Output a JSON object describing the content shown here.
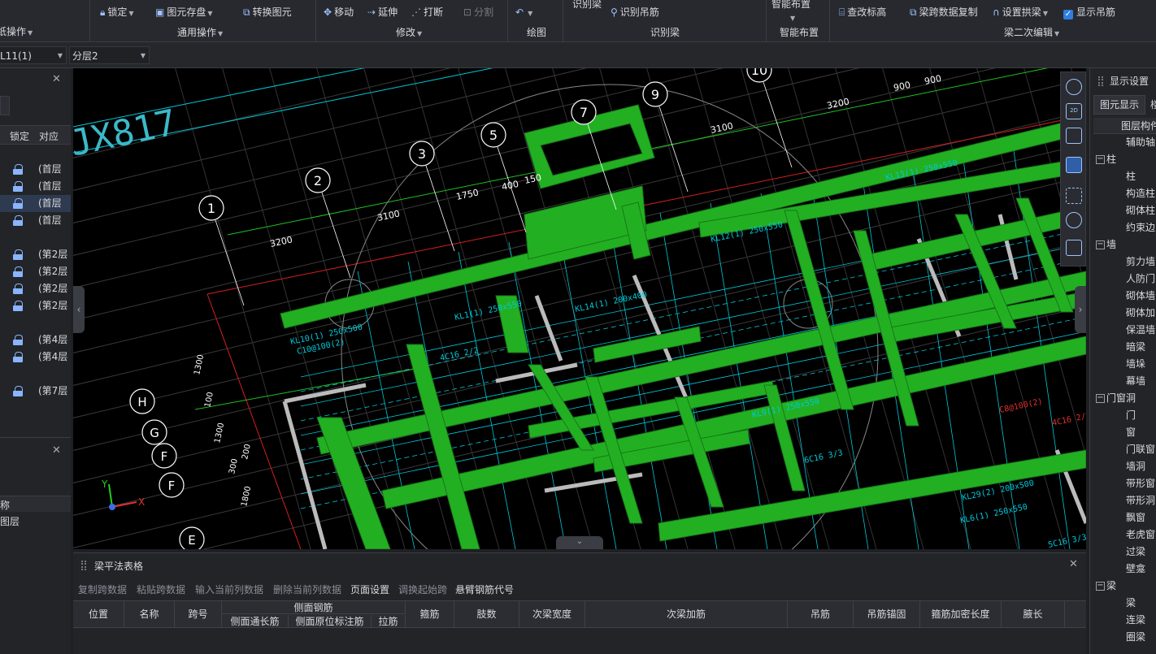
{
  "ribbon": {
    "left_group": "纸操作",
    "items": {
      "lock": "锁定",
      "save_elem": "图元存盘",
      "convert": "转换图元",
      "move": "移动",
      "extend": "延伸",
      "break": "打断",
      "split": "分割",
      "recognize_beam_top": "识别梁",
      "recognize_hanger": "识别吊筋",
      "smart_layout": "智能布置",
      "check_elev": "查改标高",
      "span_copy": "梁跨数据复制",
      "set_arch": "设置拱梁",
      "show_hanger": "显示吊筋"
    },
    "groups": {
      "general": "通用操作",
      "modify": "修改",
      "draw": "绘图",
      "recognize": "识别梁",
      "smart": "智能布置",
      "secondary": "梁二次编辑"
    }
  },
  "selectors": {
    "member": "L11(1)",
    "layer": "分层2"
  },
  "left_panel": {
    "col_lock": "锁定",
    "col_match": "对应",
    "rows": [
      "(首层",
      "(首层",
      "(首层",
      "(首层",
      "(第2层",
      "(第2层",
      "(第2层",
      "(第2层",
      "(第4层",
      "(第4层",
      "(第7层"
    ],
    "bottom_rows": [
      "称",
      "图层"
    ]
  },
  "cad": {
    "title_text": "JX817",
    "axis_numbers": [
      "1",
      "2",
      "3",
      "5",
      "7",
      "9",
      "10"
    ],
    "axis_letters": [
      "H",
      "G",
      "F",
      "F",
      "E"
    ],
    "dims_top": [
      "3200",
      "3100",
      "1750",
      "400",
      "150",
      "3100",
      "3200",
      "900",
      "900"
    ],
    "dims_left": [
      "1300",
      "100",
      "1300",
      "200",
      "300",
      "1800"
    ],
    "beam_labels": [
      "KL10(1) 250x500",
      "C10@100(2)",
      "KL1(1) 250x550",
      "KL14(1) 200x400",
      "KL13(1) 250x550",
      "KL12(1) 250x550",
      "KL9(1) 250x550",
      "KL29(2) 200x500",
      "KL6(1) 250x550",
      "4C16 2/2",
      "C8@100(2)",
      "4C16 2/2",
      "6C16 3/3",
      "5C16 3/3"
    ],
    "axis_x_label": "X",
    "axis_y_label": "Y"
  },
  "right_panel": {
    "title": "显示设置",
    "tab": "图元显示",
    "tab2": "楼",
    "header": "图层构件",
    "tree": [
      {
        "label": "辅助轴",
        "level": 2
      },
      {
        "label": "柱",
        "level": 1
      },
      {
        "label": "柱",
        "level": 2
      },
      {
        "label": "构造柱",
        "level": 2
      },
      {
        "label": "砌体柱",
        "level": 2
      },
      {
        "label": "约束边",
        "level": 2
      },
      {
        "label": "墙",
        "level": 1
      },
      {
        "label": "剪力墙",
        "level": 2
      },
      {
        "label": "人防门",
        "level": 2
      },
      {
        "label": "砌体墙",
        "level": 2
      },
      {
        "label": "砌体加",
        "level": 2
      },
      {
        "label": "保温墙",
        "level": 2
      },
      {
        "label": "暗梁",
        "level": 2
      },
      {
        "label": "墙垛",
        "level": 2
      },
      {
        "label": "幕墙",
        "level": 2
      },
      {
        "label": "门窗洞",
        "level": 1
      },
      {
        "label": "门",
        "level": 2
      },
      {
        "label": "窗",
        "level": 2
      },
      {
        "label": "门联窗",
        "level": 2
      },
      {
        "label": "墙洞",
        "level": 2
      },
      {
        "label": "带形窗",
        "level": 2
      },
      {
        "label": "带形洞",
        "level": 2
      },
      {
        "label": "飘窗",
        "level": 2
      },
      {
        "label": "老虎窗",
        "level": 2
      },
      {
        "label": "过梁",
        "level": 2
      },
      {
        "label": "壁龛",
        "level": 2
      },
      {
        "label": "梁",
        "level": 1
      },
      {
        "label": "梁",
        "level": 2
      },
      {
        "label": "连梁",
        "level": 2
      },
      {
        "label": "圈梁",
        "level": 2
      }
    ]
  },
  "bottom_panel": {
    "title": "梁平法表格",
    "toolbar": [
      {
        "label": "复制跨数据",
        "enabled": false
      },
      {
        "label": "粘贴跨数据",
        "enabled": false
      },
      {
        "label": "输入当前列数据",
        "enabled": false
      },
      {
        "label": "删除当前列数据",
        "enabled": false
      },
      {
        "label": "页面设置",
        "enabled": true
      },
      {
        "label": "调换起始跨",
        "enabled": false
      },
      {
        "label": "悬臂钢筋代号",
        "enabled": true
      }
    ],
    "columns": {
      "pos": "位置",
      "name": "名称",
      "span": "跨号",
      "side": "侧面钢筋",
      "side_long": "侧面通长筋",
      "side_mark": "侧面原位标注筋",
      "tie": "拉筋",
      "stirrup": "箍筋",
      "legs": "肢数",
      "sec_width": "次梁宽度",
      "sec_add": "次梁加筋",
      "hanger": "吊筋",
      "hanger_anchor": "吊筋锚固",
      "stirrup_dense": "箍筋加密长度",
      "haunch": "腋长"
    }
  },
  "colors": {
    "beam_green": "#22b022",
    "accent": "#9ec3ff",
    "cad_cyan": "#00c8d8"
  }
}
